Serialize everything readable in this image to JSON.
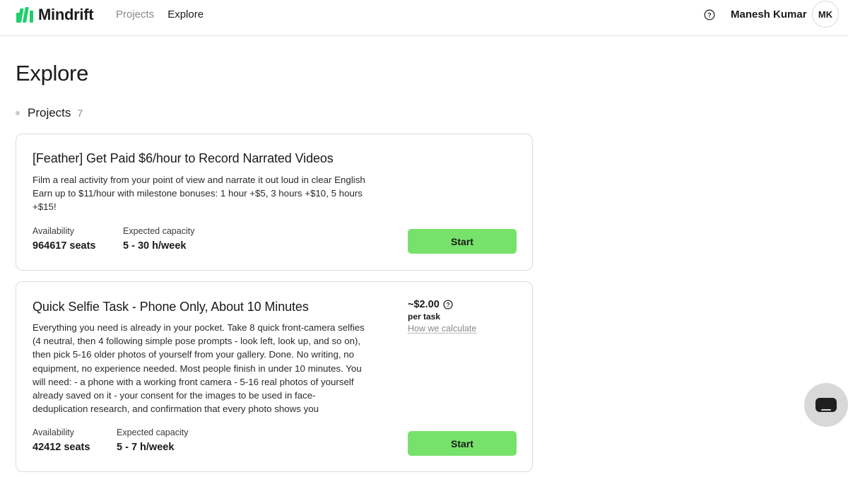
{
  "header": {
    "brand": "Mindrift",
    "nav": [
      {
        "label": "Projects",
        "active": false
      },
      {
        "label": "Explore",
        "active": true
      }
    ],
    "help_icon": "question-circle-icon",
    "user_name": "Manesh Kumar",
    "avatar_initials": "MK"
  },
  "page": {
    "title": "Explore",
    "section": {
      "title": "Projects",
      "count": "7"
    }
  },
  "projects": [
    {
      "title": "[Feather] Get Paid $6/hour to Record Narrated Videos",
      "description_lines": [
        "Film a real activity from your point of view and narrate it out loud in clear English",
        "Earn up to $11/hour with milestone bonuses: 1 hour +$5,  3 hours +$10,  5 hours",
        "+$15!"
      ],
      "availability_label": "Availability",
      "availability_value": "964617 seats",
      "capacity_label": "Expected capacity",
      "capacity_value": "5 - 30 h/week",
      "start_label": "Start"
    },
    {
      "title": "Quick Selfie Task - Phone Only, About 10 Minutes",
      "description_lines": [
        "Everything you need is already in your pocket. Take 8 quick front-camera selfies",
        "(4 neutral, then 4 following simple pose prompts - look left, look up, and so on),",
        "then pick 5-16 older photos of yourself from your gallery. Done. No writing, no",
        "equipment, no experience needed. Most people finish in under 10 minutes. You",
        "will need: - a phone with a working front camera - 5-16 real photos of yourself",
        "already saved on it - your consent for the images to be used in face-",
        "deduplication research, and confirmation that every photo shows you"
      ],
      "price": "~$2.00",
      "price_unit": "per task",
      "price_link": "How we calculate",
      "availability_label": "Availability",
      "availability_value": "42412 seats",
      "capacity_label": "Expected capacity",
      "capacity_value": "5 - 7 h/week",
      "start_label": "Start"
    }
  ],
  "colors": {
    "brand_green": "#1fcf6b",
    "start_button": "#77e26b",
    "card_border": "#d5dbe6"
  },
  "chat_widget_icon": "chat-icon"
}
